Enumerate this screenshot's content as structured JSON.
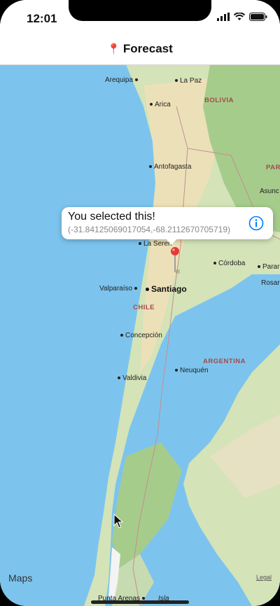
{
  "status": {
    "time": "12:01"
  },
  "nav": {
    "title": "Forecast",
    "pin_icon": "📍"
  },
  "map": {
    "cities": [
      {
        "name": "Arequipa"
      },
      {
        "name": "La Paz"
      },
      {
        "name": "Arica"
      },
      {
        "name": "Antofagasta"
      },
      {
        "name": "La Seren"
      },
      {
        "name": "Córdoba"
      },
      {
        "name": "Valparaíso"
      },
      {
        "name": "Rosar"
      },
      {
        "name": "Concepción"
      },
      {
        "name": "Neuquén"
      },
      {
        "name": "Valdivia"
      },
      {
        "name": "Asunc"
      },
      {
        "name": "Parar"
      },
      {
        "name": "Punta Arenas"
      }
    ],
    "countries": [
      {
        "name": "BOLIVIA"
      },
      {
        "name": "CHILE"
      },
      {
        "name": "ARGENTINA"
      },
      {
        "name": "PAR"
      }
    ],
    "capital": "Santiago",
    "island_label": "Isla",
    "callout": {
      "title": "You selected this!",
      "subtitle": "(-31.84125069017054,-68.2112670705719)"
    },
    "attribution": "Maps",
    "legal": "Legal"
  },
  "colors": {
    "water": "#7cc4ee",
    "land": "#d4e3b8",
    "desert": "#ece0b8",
    "green": "#a6cc8c",
    "accent": "#007aff",
    "pin": "#e53935"
  }
}
